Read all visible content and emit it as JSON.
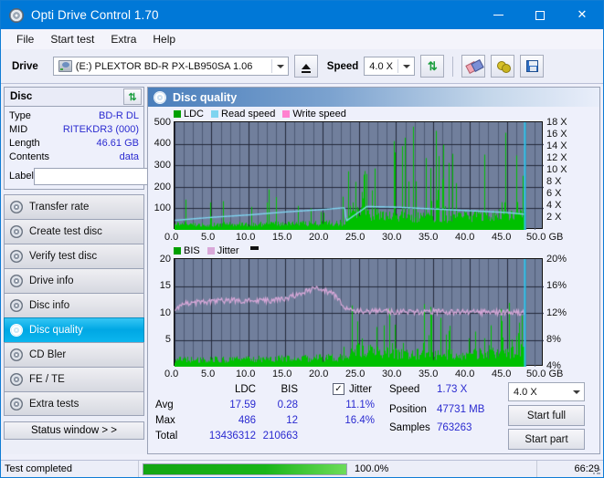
{
  "window": {
    "title": "Opti Drive Control 1.70",
    "icon": "disc-icon",
    "minimize_label": "—",
    "maximize_label": "□",
    "close_label": "✕"
  },
  "menu": {
    "items": [
      "File",
      "Start test",
      "Extra",
      "Help"
    ]
  },
  "toolbar": {
    "drive_label": "Drive",
    "drive_value": "(E:)  PLEXTOR BD-R  PX-LB950SA 1.06",
    "eject_icon": "eject-icon",
    "speed_label": "Speed",
    "speed_value": "4.0 X",
    "refresh_icon": "refresh-icon",
    "erase_icon": "eraser-icon",
    "bulb_icon": "bulb-icon",
    "save_icon": "save-icon"
  },
  "disc_panel": {
    "title": "Disc",
    "refresh_icon": "refresh-icon",
    "rows": [
      {
        "key": "Type",
        "value": "BD-R DL"
      },
      {
        "key": "MID",
        "value": "RITEKDR3 (000)"
      },
      {
        "key": "Length",
        "value": "46.61 GB"
      },
      {
        "key": "Contents",
        "value": "data"
      }
    ],
    "label_key": "Label",
    "label_value": "",
    "label_placeholder": "",
    "cd_icon": "disc-icon"
  },
  "sidebar": {
    "items": [
      {
        "label": "Transfer rate",
        "icon": "disc-icon",
        "active": false
      },
      {
        "label": "Create test disc",
        "icon": "disc-icon",
        "active": false
      },
      {
        "label": "Verify test disc",
        "icon": "disc-icon",
        "active": false
      },
      {
        "label": "Drive info",
        "icon": "disc-icon",
        "active": false
      },
      {
        "label": "Disc info",
        "icon": "disc-icon",
        "active": false
      },
      {
        "label": "Disc quality",
        "icon": "disc-icon",
        "active": true
      },
      {
        "label": "CD Bler",
        "icon": "disc-icon",
        "active": false
      },
      {
        "label": "FE / TE",
        "icon": "disc-icon",
        "active": false
      },
      {
        "label": "Extra tests",
        "icon": "disc-icon",
        "active": false
      }
    ],
    "status_window_label": "Status window > >"
  },
  "main": {
    "header_title": "Disc quality",
    "header_icon": "disc-icon"
  },
  "chart_data": [
    {
      "type": "area",
      "name": "top-chart",
      "title": "",
      "xlabel": "",
      "ylabel": "",
      "xlim": [
        0,
        50
      ],
      "ylim": [
        0,
        500
      ],
      "y2lim": [
        0,
        18
      ],
      "grid": true,
      "legend_position": "top-left",
      "legend": [
        {
          "name": "LDC",
          "color": "#00a000"
        },
        {
          "name": "Read speed",
          "color": "#7fd4f0"
        },
        {
          "name": "Write speed",
          "color": "#ff80d0"
        }
      ],
      "xticks": [
        "0.0",
        "5.0",
        "10.0",
        "15.0",
        "20.0",
        "25.0",
        "30.0",
        "35.0",
        "40.0",
        "45.0",
        "50.0 GB"
      ],
      "yticks": [
        "100",
        "200",
        "300",
        "400",
        "500"
      ],
      "y2ticks": [
        "2 X",
        "4 X",
        "6 X",
        "8 X",
        "10 X",
        "12 X",
        "14 X",
        "16 X",
        "18 X"
      ],
      "series": [
        {
          "name": "LDC",
          "type": "spikes",
          "color": "#00c000",
          "baseline_x": [
            0,
            5,
            10,
            15,
            20,
            23,
            24,
            26,
            30,
            35,
            40,
            45,
            47.5
          ],
          "baseline_y": [
            28,
            26,
            26,
            28,
            30,
            32,
            95,
            75,
            60,
            58,
            62,
            70,
            70
          ],
          "spike_max": 486,
          "notes": "dense green spikes, much taller and denser after 23 GB layer break"
        },
        {
          "name": "Read speed",
          "type": "line",
          "color": "#7fd4f0",
          "axis": "y2",
          "x": [
            0,
            5,
            10,
            15,
            20,
            23,
            23.2,
            26,
            30,
            35,
            40,
            45,
            47.4
          ],
          "y": [
            1.6,
            2.1,
            2.5,
            3.0,
            3.4,
            3.7,
            1.5,
            3.9,
            3.8,
            3.5,
            3.2,
            2.9,
            2.6
          ]
        }
      ],
      "marker_line_x": 47.4,
      "marker_line_color": "#30c8f0"
    },
    {
      "type": "area",
      "name": "bottom-chart",
      "title": "",
      "xlabel": "",
      "ylabel": "",
      "xlim": [
        0,
        50
      ],
      "ylim": [
        0,
        20
      ],
      "y2lim": [
        0,
        20
      ],
      "grid": true,
      "legend_position": "top-left",
      "legend": [
        {
          "name": "BIS",
          "color": "#00a000"
        },
        {
          "name": "Jitter",
          "color": "#d9a8d9"
        }
      ],
      "xticks": [
        "0.0",
        "5.0",
        "10.0",
        "15.0",
        "20.0",
        "25.0",
        "30.0",
        "35.0",
        "40.0",
        "45.0",
        "50.0 GB"
      ],
      "yticks": [
        "5",
        "10",
        "15",
        "20"
      ],
      "y2ticks": [
        "4%",
        "8%",
        "12%",
        "16%",
        "20%"
      ],
      "series": [
        {
          "name": "BIS",
          "type": "spikes",
          "color": "#00c000",
          "baseline_x": [
            0,
            5,
            10,
            15,
            20,
            23,
            24,
            30,
            35,
            40,
            45,
            47.5
          ],
          "baseline_y": [
            1.3,
            1.3,
            1.4,
            1.5,
            1.6,
            1.7,
            3.2,
            2.4,
            2.2,
            2.3,
            2.6,
            2.6
          ],
          "spike_max": 12
        },
        {
          "name": "Jitter",
          "type": "line",
          "color": "#d9a8d9",
          "axis": "y2",
          "x": [
            0,
            1,
            3,
            6,
            9,
            12,
            15,
            17,
            19,
            20,
            21,
            22,
            23,
            23.5,
            26,
            30,
            35,
            40,
            45,
            47.4
          ],
          "y": [
            10.6,
            11.6,
            12.0,
            12.2,
            12.3,
            12.2,
            12.6,
            13.6,
            14.6,
            14.2,
            13.9,
            12.9,
            11.0,
            10.6,
            10.3,
            10.2,
            10.2,
            10.1,
            10.1,
            10.0
          ]
        }
      ],
      "marker_line_x": 47.4,
      "marker_line_color": "#30c8f0"
    }
  ],
  "stats": {
    "col_headers": [
      "LDC",
      "BIS"
    ],
    "rows": [
      {
        "label": "Avg",
        "ldc": "17.59",
        "bis": "0.28"
      },
      {
        "label": "Max",
        "ldc": "486",
        "bis": "12"
      },
      {
        "label": "Total",
        "ldc": "13436312",
        "bis": "210663"
      }
    ],
    "jitter": {
      "checkbox_label": "Jitter",
      "checked": true,
      "checkmark": "✓",
      "avg": "11.1%",
      "max": "16.4%"
    },
    "info": [
      {
        "label": "Speed",
        "value": "1.73 X"
      },
      {
        "label": "Position",
        "value": "47731 MB"
      },
      {
        "label": "Samples",
        "value": "763263"
      }
    ],
    "speed_select_value": "4.0 X",
    "start_full_label": "Start full",
    "start_part_label": "Start part"
  },
  "statusbar": {
    "message": "Test completed",
    "progress_percent": "100.0%",
    "progress_value": 100,
    "elapsed": "66:29"
  }
}
